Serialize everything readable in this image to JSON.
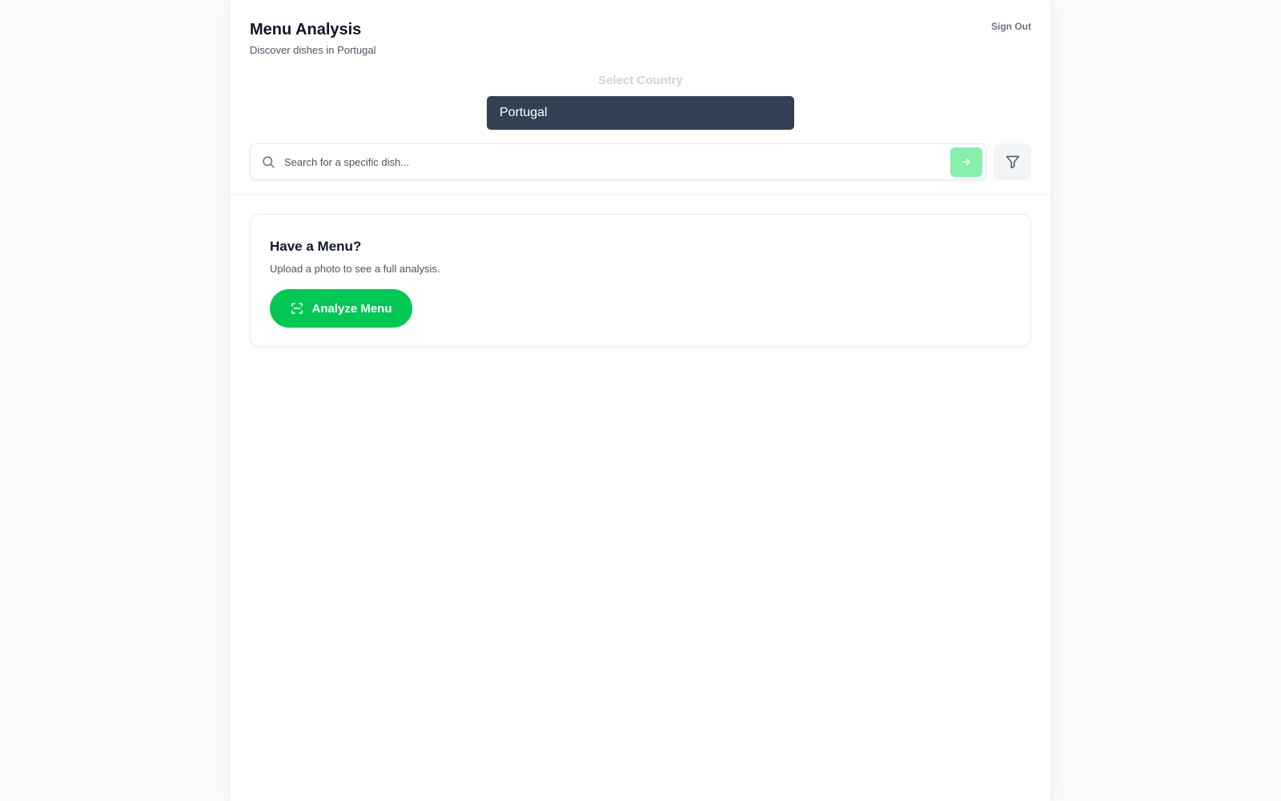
{
  "header": {
    "title": "Menu Analysis",
    "subtitle": "Discover dishes in Portugal",
    "sign_out_label": "Sign Out"
  },
  "country": {
    "label": "Select Country",
    "selected": "Portugal"
  },
  "search": {
    "placeholder": "Search for a specific dish...",
    "value": "",
    "icon": "search-icon",
    "submit_icon": "arrow-right-icon"
  },
  "filter": {
    "icon": "filter-icon"
  },
  "menu_card": {
    "title": "Have a Menu?",
    "description": "Upload a photo to see a full analysis.",
    "button_label": "Analyze Menu",
    "button_icon": "scan-icon"
  },
  "colors": {
    "accent_green": "#00c853",
    "submit_green_light": "#86efac",
    "select_bg": "#334155",
    "page_bg": "#f8fafc"
  }
}
